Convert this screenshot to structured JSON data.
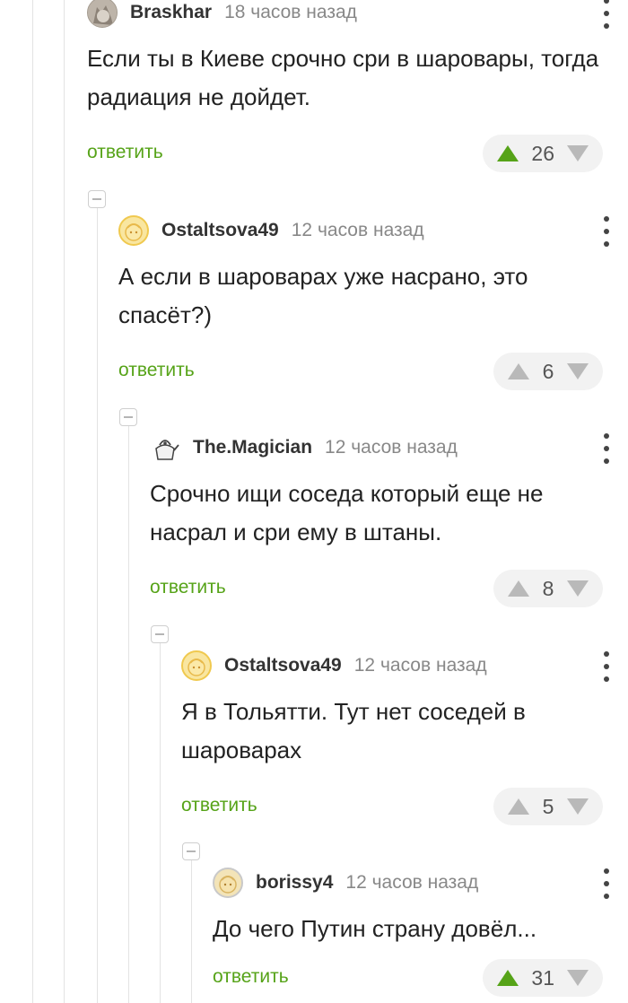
{
  "comments": [
    {
      "username": "Braskhar",
      "time": "18 часов назад",
      "avatar": "cat-avatar",
      "text": "Если ты в Киеве срочно сри в шаровары, тогда радиация не дойдет.",
      "reply_label": "ответить",
      "votes": "26",
      "upvoted": true
    },
    {
      "username": "Ostaltsova49",
      "time": "12 часов назад",
      "avatar": "yellow-face-avatar",
      "text": "А если в шароварах уже насрано, это спасёт?)",
      "reply_label": "ответить",
      "votes": "6",
      "upvoted": false
    },
    {
      "username": "The.Magician",
      "time": "12 часов назад",
      "avatar": "kettle-avatar",
      "text": "Срочно ищи соседа который еще не насрал и сри ему в штаны.",
      "reply_label": "ответить",
      "votes": "8",
      "upvoted": false
    },
    {
      "username": "Ostaltsova49",
      "time": "12 часов назад",
      "avatar": "yellow-face-avatar",
      "text": "Я в Тольятти. Тут нет соседей в шароварах",
      "reply_label": "ответить",
      "votes": "5",
      "upvoted": false
    },
    {
      "username": "borissy4",
      "time": "12 часов назад",
      "avatar": "grey-face-avatar",
      "text": "До чего Путин страну довёл...",
      "reply_label": "ответить",
      "votes": "31",
      "upvoted": true
    }
  ],
  "colors": {
    "accent_green": "#56a318",
    "muted_grey": "#888888",
    "vote_bg": "#f2f2f2"
  }
}
